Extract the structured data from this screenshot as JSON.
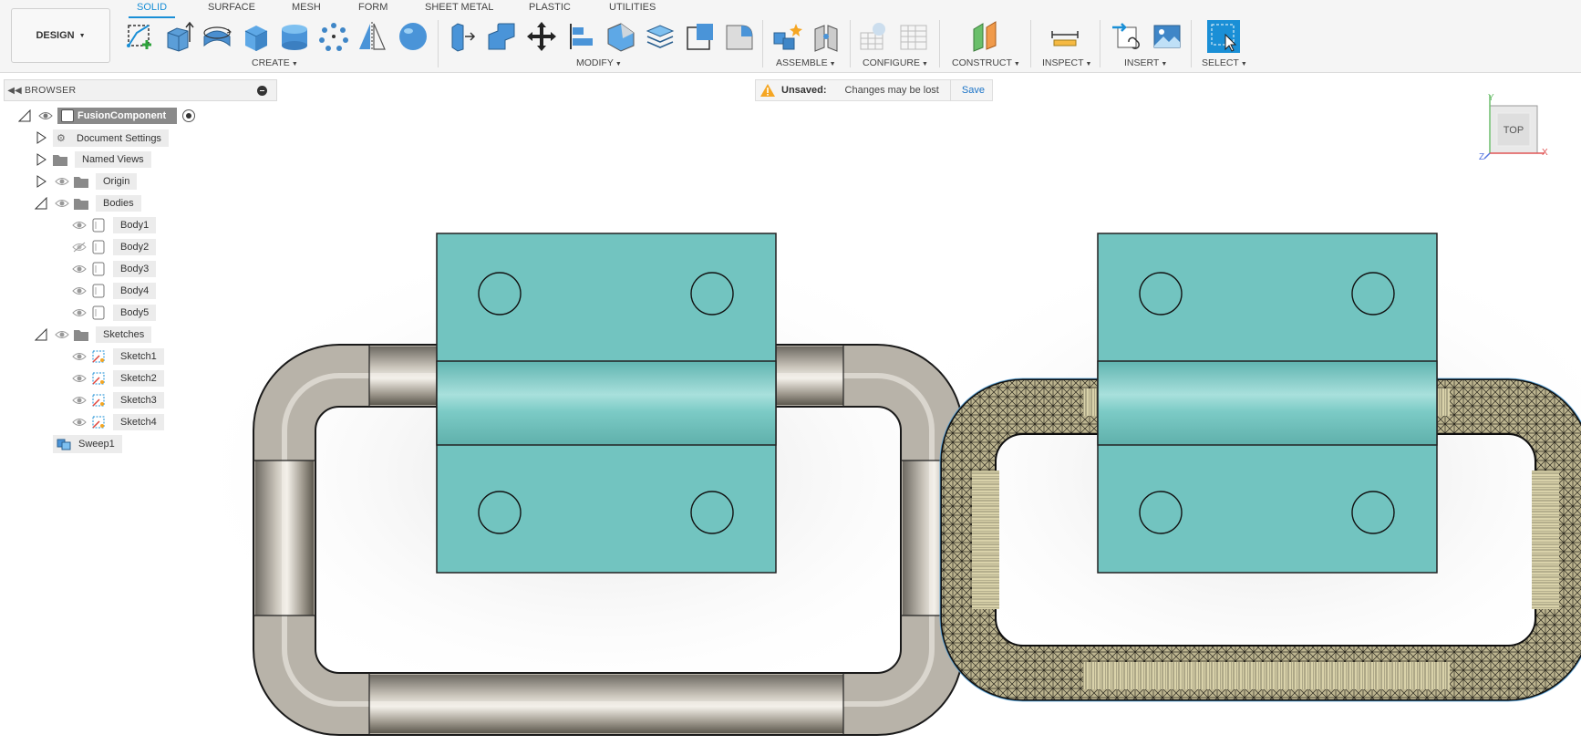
{
  "toolbar": {
    "workspace_button": "DESIGN",
    "tabs": [
      "SOLID",
      "SURFACE",
      "MESH",
      "FORM",
      "SHEET METAL",
      "PLASTIC",
      "UTILITIES"
    ],
    "active_tab": "SOLID",
    "groups": {
      "create": "CREATE",
      "modify": "MODIFY",
      "assemble": "ASSEMBLE",
      "configure": "CONFIGURE",
      "construct": "CONSTRUCT",
      "inspect": "INSPECT",
      "insert": "INSERT",
      "select": "SELECT"
    }
  },
  "browser": {
    "title": "BROWSER",
    "root": "FusionComponent",
    "document_settings": "Document Settings",
    "named_views": "Named Views",
    "origin": "Origin",
    "bodies": "Bodies",
    "body_items": [
      "Body1",
      "Body2",
      "Body3",
      "Body4",
      "Body5"
    ],
    "sketches": "Sketches",
    "sketch_items": [
      "Sketch1",
      "Sketch2",
      "Sketch3",
      "Sketch4"
    ],
    "sweep": "Sweep1"
  },
  "unsaved": {
    "label": "Unsaved:",
    "message": "Changes may be lost",
    "save": "Save"
  },
  "viewcube": {
    "face": "TOP",
    "axis_x": "X",
    "axis_y": "Y",
    "axis_z": "Z"
  },
  "colors": {
    "accent": "#1a8fd6",
    "plate": "#72c4c0",
    "handle_steel": "#9c978d",
    "mesh_tan": "#d6cfa6"
  }
}
